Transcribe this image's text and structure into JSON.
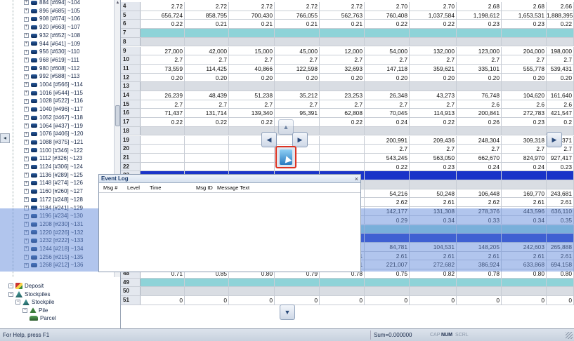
{
  "tree": {
    "items": [
      {
        "label": "884 [#694] ~104",
        "type": "folder"
      },
      {
        "label": "896 [#685] ~105",
        "type": "folder"
      },
      {
        "label": "908 [#674] ~106",
        "type": "folder"
      },
      {
        "label": "920 [#663] ~107",
        "type": "folder"
      },
      {
        "label": "932 [#652] ~108",
        "type": "folder"
      },
      {
        "label": "944 [#641] ~109",
        "type": "folder"
      },
      {
        "label": "956 [#630] ~110",
        "type": "folder"
      },
      {
        "label": "968 [#619] ~111",
        "type": "folder"
      },
      {
        "label": "980 [#608] ~112",
        "type": "folder"
      },
      {
        "label": "992 [#588] ~113",
        "type": "folder"
      },
      {
        "label": "1004 [#566] ~114",
        "type": "folder"
      },
      {
        "label": "1016 [#544] ~115",
        "type": "folder"
      },
      {
        "label": "1028 [#522] ~116",
        "type": "folder"
      },
      {
        "label": "1040 [#496] ~117",
        "type": "folder"
      },
      {
        "label": "1052 [#467] ~118",
        "type": "folder"
      },
      {
        "label": "1064 [#437] ~119",
        "type": "folder"
      },
      {
        "label": "1076 [#406] ~120",
        "type": "folder"
      },
      {
        "label": "1088 [#375] ~121",
        "type": "folder"
      },
      {
        "label": "1100 [#346] ~122",
        "type": "folder"
      },
      {
        "label": "1112 [#326] ~123",
        "type": "folder"
      },
      {
        "label": "1124 [#306] ~124",
        "type": "folder"
      },
      {
        "label": "1136 [#289] ~125",
        "type": "folder"
      },
      {
        "label": "1148 [#274] ~126",
        "type": "folder"
      },
      {
        "label": "1160 [#260] ~127",
        "type": "folder"
      },
      {
        "label": "1172 [#248] ~128",
        "type": "folder"
      },
      {
        "label": "1184 [#241] ~129",
        "type": "folder"
      },
      {
        "label": "1196 [#234] ~130",
        "type": "folder"
      },
      {
        "label": "1208 [#230] ~131",
        "type": "folder"
      },
      {
        "label": "1220 [#226] ~132",
        "type": "folder"
      },
      {
        "label": "1232 [#222] ~133",
        "type": "folder"
      },
      {
        "label": "1244 [#218] ~134",
        "type": "folder"
      },
      {
        "label": "1256 [#215] ~135",
        "type": "folder"
      },
      {
        "label": "1268 [#212] ~136",
        "type": "folder"
      }
    ],
    "bottom_items": [
      {
        "label": "Deposit",
        "type": "deposit",
        "indent": 0
      },
      {
        "label": "Stockpiles",
        "type": "stock",
        "indent": 0
      },
      {
        "label": "Stockpile",
        "type": "stock",
        "indent": 1
      },
      {
        "label": "Pile",
        "type": "pile",
        "indent": 2
      },
      {
        "label": "Parcel",
        "type": "parcel",
        "indent": 3
      }
    ]
  },
  "grid": {
    "rows": [
      {
        "num": "4",
        "style": "white",
        "cells": [
          "2.72",
          "2.72",
          "2.72",
          "2.72",
          "2.72",
          "2.70",
          "2.70",
          "2.68",
          "2.68",
          "2.66"
        ]
      },
      {
        "num": "5",
        "style": "white",
        "cells": [
          "656,724",
          "858,795",
          "700,430",
          "766,055",
          "562,763",
          "760,408",
          "1,037,584",
          "1,198,612",
          "1,653,531",
          "1,888,395"
        ]
      },
      {
        "num": "6",
        "style": "white",
        "cells": [
          "0.22",
          "0.21",
          "0.21",
          "0.21",
          "0.21",
          "0.22",
          "0.22",
          "0.23",
          "0.23",
          "0.22"
        ]
      },
      {
        "num": "7",
        "style": "teal",
        "cells": [
          "",
          "",
          "",
          "",
          "",
          "",
          "",
          "",
          "",
          ""
        ]
      },
      {
        "num": "8",
        "style": "gray",
        "cells": [
          "",
          "",
          "",
          "",
          "",
          "",
          "",
          "",
          "",
          ""
        ]
      },
      {
        "num": "9",
        "style": "white",
        "cells": [
          "27,000",
          "42,000",
          "15,000",
          "45,000",
          "12,000",
          "54,000",
          "132,000",
          "123,000",
          "204,000",
          "198,000"
        ]
      },
      {
        "num": "10",
        "style": "white",
        "cells": [
          "2.7",
          "2.7",
          "2.7",
          "2.7",
          "2.7",
          "2.7",
          "2.7",
          "2.7",
          "2.7",
          "2.7"
        ]
      },
      {
        "num": "11",
        "style": "white",
        "cells": [
          "73,559",
          "114,425",
          "40,866",
          "122,598",
          "32,693",
          "147,118",
          "359,621",
          "335,101",
          "555,778",
          "539,431"
        ]
      },
      {
        "num": "12",
        "style": "white",
        "cells": [
          "0.20",
          "0.20",
          "0.20",
          "0.20",
          "0.20",
          "0.20",
          "0.20",
          "0.20",
          "0.20",
          "0.20"
        ]
      },
      {
        "num": "13",
        "style": "gray",
        "cells": [
          "",
          "",
          "",
          "",
          "",
          "",
          "",
          "",
          "",
          ""
        ]
      },
      {
        "num": "14",
        "style": "white",
        "cells": [
          "26,239",
          "48,439",
          "51,238",
          "35,212",
          "23,253",
          "26,348",
          "43,273",
          "76,748",
          "104,620",
          "161,640"
        ]
      },
      {
        "num": "15",
        "style": "white",
        "cells": [
          "2.7",
          "2.7",
          "2.7",
          "2.7",
          "2.7",
          "2.7",
          "2.7",
          "2.6",
          "2.6",
          "2.6"
        ]
      },
      {
        "num": "16",
        "style": "white",
        "cells": [
          "71,437",
          "131,714",
          "139,340",
          "95,391",
          "62,808",
          "70,045",
          "114,913",
          "200,841",
          "272,783",
          "421,547"
        ]
      },
      {
        "num": "17",
        "style": "white",
        "cells": [
          "0.22",
          "0.22",
          "0.22",
          "",
          "0.22",
          "0.24",
          "0.22",
          "0.26",
          "0.23",
          "0.2"
        ]
      },
      {
        "num": "18",
        "style": "gray",
        "cells": [
          "",
          "",
          "",
          "",
          "",
          "",
          "",
          "",
          "",
          ""
        ]
      },
      {
        "num": "19",
        "style": "white",
        "cells": [
          "",
          "",
          "",
          "",
          "",
          "200,991",
          "209,436",
          "248,304",
          "309,318",
          "349,371"
        ]
      },
      {
        "num": "20",
        "style": "white",
        "cells": [
          "",
          "",
          "",
          "",
          "",
          "2.7",
          "2.7",
          "2.7",
          "2.7",
          "2.7"
        ]
      },
      {
        "num": "21",
        "style": "white",
        "cells": [
          "",
          "",
          "",
          "",
          "",
          "543,245",
          "563,050",
          "662,670",
          "824,970",
          "927,417"
        ]
      },
      {
        "num": "22",
        "style": "white",
        "cells": [
          "",
          "",
          "",
          "",
          "",
          "0.22",
          "0.23",
          "0.24",
          "0.24",
          "0.23"
        ]
      },
      {
        "num": "23",
        "style": "blue",
        "cells": [
          "",
          "",
          "",
          "",
          "",
          "",
          "",
          "",
          "",
          ""
        ]
      },
      {
        "num": "24",
        "style": "gray",
        "cells": [
          "",
          "",
          "",
          "",
          "",
          "",
          "",
          "",
          "",
          ""
        ]
      },
      {
        "num": "25",
        "style": "white",
        "cells": [
          "",
          "",
          "",
          "",
          "",
          "54,216",
          "50,248",
          "106,448",
          "169,770",
          "243,681"
        ]
      },
      {
        "num": "26",
        "style": "white",
        "cells": [
          "",
          "",
          "",
          "",
          "",
          "2.62",
          "2.61",
          "2.62",
          "2.61",
          "2.61"
        ]
      },
      {
        "num": "27",
        "style": "white",
        "cells": [
          "",
          "",
          "",
          "",
          "",
          "142,177",
          "131,308",
          "278,376",
          "443,596",
          "636,110"
        ]
      },
      {
        "num": "28",
        "style": "white",
        "cells": [
          "",
          "",
          "",
          "",
          "",
          "0.29",
          "0.34",
          "0.33",
          "0.34",
          "0.35"
        ]
      },
      {
        "num": "29",
        "style": "teal",
        "cells": [
          "",
          "",
          "",
          "",
          "",
          "",
          "",
          "",
          "",
          ""
        ]
      },
      {
        "num": "30",
        "style": "blue",
        "cells": [
          "",
          "",
          "",
          "",
          "",
          "",
          "",
          "",
          "",
          ""
        ]
      },
      {
        "num": "31",
        "style": "white",
        "cells": [
          "",
          "",
          "",
          "",
          "",
          "84,781",
          "104,531",
          "148,205",
          "242,603",
          "265,888"
        ]
      },
      {
        "num": "46",
        "style": "white",
        "cells": [
          "2.61",
          "2.61",
          "2.61",
          "2.61",
          "2.61",
          "2.61",
          "2.61",
          "2.61",
          "2.61",
          "2.61"
        ]
      },
      {
        "num": "47",
        "style": "white",
        "cells": [
          "44,182",
          "22,121",
          "42,267",
          "155,336",
          "194,541",
          "221,007",
          "272,682",
          "386,924",
          "633,868",
          "694,158"
        ]
      },
      {
        "num": "48",
        "style": "white",
        "cells": [
          "0.71",
          "0.85",
          "0.80",
          "0.79",
          "0.78",
          "0.75",
          "0.82",
          "0.78",
          "0.80",
          "0.80"
        ]
      },
      {
        "num": "49",
        "style": "teal",
        "cells": [
          "",
          "",
          "",
          "",
          "",
          "",
          "",
          "",
          "",
          ""
        ]
      },
      {
        "num": "50",
        "style": "gray",
        "cells": [
          "",
          "",
          "",
          "",
          "",
          "",
          "",
          "",
          "",
          ""
        ]
      },
      {
        "num": "51",
        "style": "white",
        "cells": [
          "0",
          "0",
          "0",
          "0",
          "0",
          "0",
          "0",
          "0",
          "0",
          "0"
        ]
      }
    ]
  },
  "event_log": {
    "title": "Event Log",
    "close": "×",
    "columns": [
      "Msg #",
      "Level",
      "Time",
      "Msg ID",
      "Message Text"
    ]
  },
  "dock": {
    "up": "▲",
    "down": "▼",
    "left": "◀",
    "right": "▶"
  },
  "status": {
    "help": "For Help, press F1",
    "sum": "Sum=0.000000",
    "cap": "CAP",
    "num": "NUM",
    "scrl": "SCRL"
  }
}
